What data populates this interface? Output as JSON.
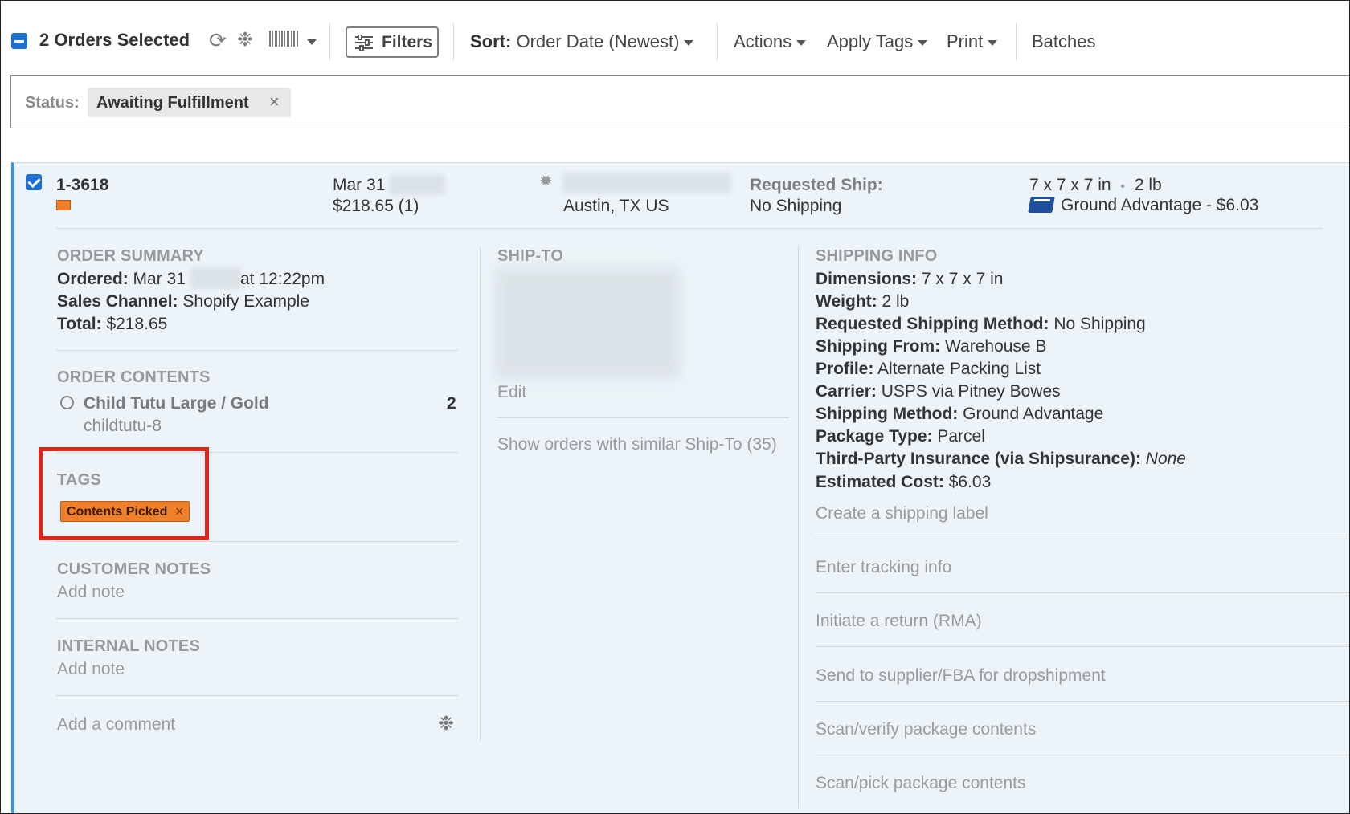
{
  "toolbar": {
    "selected_label": "2 Orders Selected",
    "refresh_icon": "refresh-icon",
    "gear_icon": "gear-icon",
    "barcode_icon": "barcode-icon",
    "filters_label": "Filters",
    "sort_label": "Sort:",
    "sort_value": "Order Date (Newest)",
    "actions_label": "Actions",
    "apply_tags_label": "Apply Tags",
    "print_label": "Print",
    "batches_label": "Batches"
  },
  "status_filter": {
    "label": "Status:",
    "value": "Awaiting Fulfillment",
    "remove": "×"
  },
  "order": {
    "number": "1-3618",
    "date": "Mar 31",
    "total_qty": "$218.65 (1)",
    "location": "Austin, TX US",
    "requested_ship_label": "Requested Ship:",
    "requested_ship_value": "No Shipping",
    "dims_weight": "7 x 7 x 7 in",
    "weight_short": "2 lb",
    "bullet": "•",
    "service": "Ground Advantage - $6.03",
    "summary": {
      "heading": "ORDER SUMMARY",
      "ordered_label": "Ordered:",
      "ordered_date": "Mar 31",
      "ordered_time": "at 12:22pm",
      "channel_label": "Sales Channel:",
      "channel_value": "Shopify Example",
      "total_label": "Total:",
      "total_value": "$218.65"
    },
    "contents": {
      "heading": "ORDER CONTENTS",
      "items": [
        {
          "name": "Child Tutu Large / Gold",
          "sku": "childtutu-8",
          "qty": "2"
        }
      ]
    },
    "tags": {
      "heading": "TAGS",
      "items": [
        {
          "label": "Contents Picked",
          "remove": "×"
        }
      ]
    },
    "customer_notes": {
      "heading": "CUSTOMER NOTES",
      "action": "Add note"
    },
    "internal_notes": {
      "heading": "INTERNAL NOTES",
      "action": "Add note"
    },
    "comment_placeholder": "Add a comment",
    "ship_to": {
      "heading": "SHIP-TO",
      "edit": "Edit",
      "similar": "Show orders with similar Ship-To (35)"
    },
    "shipping_info": {
      "heading": "SHIPPING INFO",
      "rows": [
        {
          "label": "Dimensions:",
          "value": "7 x 7 x 7 in"
        },
        {
          "label": "Weight:",
          "value": "2 lb"
        },
        {
          "label": "Requested Shipping Method:",
          "value": "No Shipping"
        },
        {
          "label": "Shipping From:",
          "value": "Warehouse B"
        },
        {
          "label": "Profile:",
          "value": "Alternate Packing List"
        },
        {
          "label": "Carrier:",
          "value": "USPS via Pitney Bowes"
        },
        {
          "label": "Shipping Method:",
          "value": "Ground Advantage"
        },
        {
          "label": "Package Type:",
          "value": "Parcel"
        },
        {
          "label": "Third-Party Insurance (via Shipsurance):",
          "value": "None"
        },
        {
          "label": "Estimated Cost:",
          "value": "$6.03"
        }
      ],
      "actions": [
        "Create a shipping label",
        "Enter tracking info",
        "Initiate a return (RMA)",
        "Send to supplier/FBA for dropshipment",
        "Scan/verify package contents",
        "Scan/pick package contents"
      ]
    }
  },
  "colors": {
    "accent_blue": "#1a6fd1",
    "tag_orange": "#f07f2a",
    "highlight_red": "#e1241a",
    "card_bg": "#edf4f9"
  }
}
